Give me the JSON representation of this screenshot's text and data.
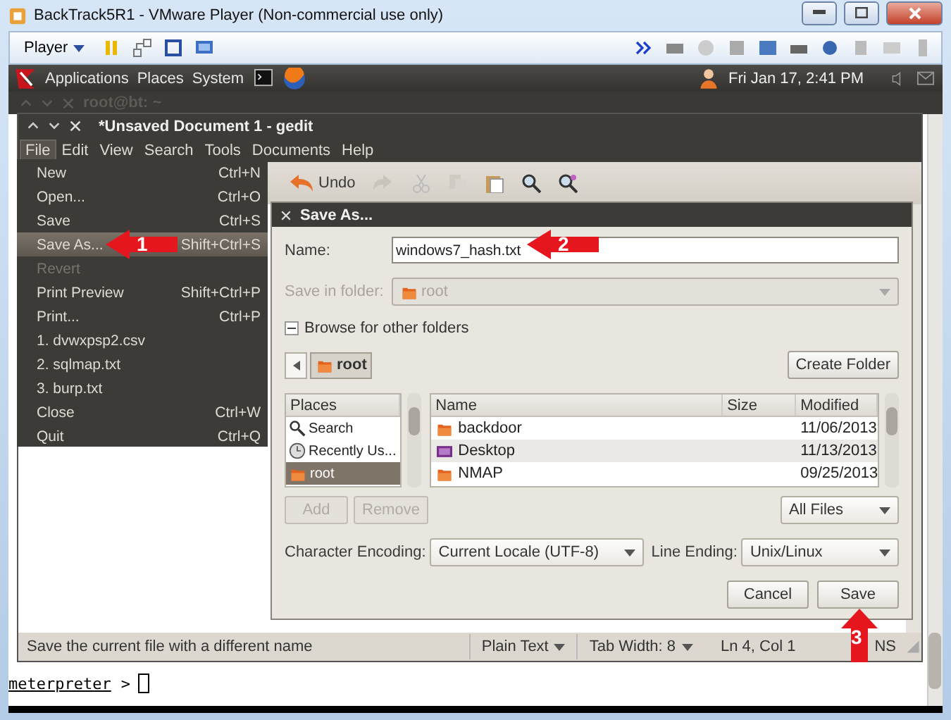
{
  "window": {
    "title": "BackTrack5R1 - VMware Player (Non-commercial use only)"
  },
  "player_toolbar": {
    "menu": "Player"
  },
  "panel": {
    "menus": [
      "Applications",
      "Places",
      "System"
    ],
    "clock": "Fri Jan 17,  2:41 PM"
  },
  "terminal": {
    "title": "root@bt: ~",
    "prompt": "meterpreter",
    "prompt_symbol": ">"
  },
  "gedit": {
    "title": "*Unsaved Document 1 - gedit",
    "menus": [
      {
        "label": "File",
        "selected": true
      },
      {
        "label": "Edit",
        "selected": false
      },
      {
        "label": "View",
        "selected": false
      },
      {
        "label": "Search",
        "selected": false
      },
      {
        "label": "Tools",
        "selected": false
      },
      {
        "label": "Documents",
        "selected": false
      },
      {
        "label": "Help",
        "selected": false
      }
    ],
    "toolbar": {
      "undo": "Undo"
    },
    "status": {
      "message": "Save the current file with a different name",
      "language": "Plain Text",
      "tab_width": "Tab Width:  8",
      "position": "Ln 4, Col 1",
      "mode": "NS"
    }
  },
  "file_menu": [
    {
      "label": "New",
      "shortcut": "Ctrl+N",
      "selected": false,
      "disabled": false
    },
    {
      "label": "Open...",
      "shortcut": "Ctrl+O",
      "selected": false,
      "disabled": false
    },
    {
      "label": "Save",
      "shortcut": "Ctrl+S",
      "selected": false,
      "disabled": false
    },
    {
      "label": "Save As...",
      "shortcut": "Shift+Ctrl+S",
      "selected": true,
      "disabled": false
    },
    {
      "label": "Revert",
      "selected": false,
      "disabled": true
    },
    {
      "label": "Print Preview",
      "shortcut": "Shift+Ctrl+P",
      "selected": false,
      "disabled": false
    },
    {
      "label": "Print...",
      "shortcut": "Ctrl+P",
      "selected": false,
      "disabled": false
    },
    {
      "label": "1.  dvwxpsp2.csv",
      "selected": false,
      "disabled": false
    },
    {
      "label": "2.  sqlmap.txt",
      "selected": false,
      "disabled": false
    },
    {
      "label": "3.  burp.txt",
      "selected": false,
      "disabled": false
    },
    {
      "label": "Close",
      "shortcut": "Ctrl+W",
      "selected": false,
      "disabled": false
    },
    {
      "label": "Quit",
      "shortcut": "Ctrl+Q",
      "selected": false,
      "disabled": false
    }
  ],
  "dialog": {
    "title": "Save As...",
    "name_label": "Name:",
    "name_value": "windows7_hash.txt",
    "folder_label": "Save in folder:",
    "folder_value": "root",
    "folder_disabled": true,
    "browse_label": "Browse for other folders",
    "browse_expanded": true,
    "path": "root",
    "create_folder": "Create Folder",
    "places_header": "Places",
    "places": [
      {
        "label": "Search",
        "kind": "search",
        "selected": false
      },
      {
        "label": "Recently Us...",
        "kind": "recent",
        "selected": false
      },
      {
        "label": "root",
        "kind": "folder",
        "selected": true
      }
    ],
    "places_buttons": [
      {
        "label": "Add",
        "disabled": true
      },
      {
        "label": "Remove",
        "disabled": true
      }
    ],
    "columns": [
      "Name",
      "Size",
      "Modified"
    ],
    "files": [
      {
        "name": "backdoor",
        "kind": "folder",
        "modified": "11/06/2013"
      },
      {
        "name": "Desktop",
        "kind": "desktop",
        "modified": "11/13/2013"
      },
      {
        "name": "NMAP",
        "kind": "folder",
        "modified": "09/25/2013"
      }
    ],
    "filter": "All Files",
    "encoding_label": "Character Encoding:",
    "encoding": "Current Locale (UTF-8)",
    "line_ending_label": "Line Ending:",
    "line_ending": "Unix/Linux",
    "buttons": [
      "Cancel",
      "Save"
    ]
  },
  "annotations": [
    {
      "number": "1"
    },
    {
      "number": "2"
    },
    {
      "number": "3"
    }
  ]
}
